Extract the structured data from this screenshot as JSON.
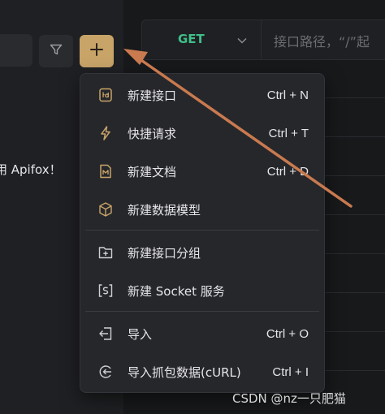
{
  "sidebar": {
    "welcome_text": "用 Apifox！"
  },
  "request": {
    "method": "GET",
    "url_placeholder": "接口路径，“/”起"
  },
  "menu": {
    "items": [
      {
        "label": "新建接口",
        "shortcut": "Ctrl + N",
        "icon": "api-icon"
      },
      {
        "label": "快捷请求",
        "shortcut": "Ctrl + T",
        "icon": "lightning-icon"
      },
      {
        "label": "新建文档",
        "shortcut": "Ctrl + D",
        "icon": "markdown-doc-icon"
      },
      {
        "label": "新建数据模型",
        "shortcut": "",
        "icon": "cube-icon"
      },
      {
        "label": "新建接口分组",
        "shortcut": "",
        "icon": "folder-add-icon"
      },
      {
        "label": "新建 Socket 服务",
        "shortcut": "",
        "icon": "socket-icon"
      },
      {
        "label": "导入",
        "shortcut": "Ctrl + O",
        "icon": "import-icon"
      },
      {
        "label": "导入抓包数据(cURL)",
        "shortcut": "Ctrl + I",
        "icon": "curl-import-icon"
      }
    ]
  },
  "watermark": "CSDN @nz一只肥猫",
  "colors": {
    "accent": "#c8a469",
    "method_get": "#3fbf8a",
    "annotation": "#c97a4f"
  }
}
